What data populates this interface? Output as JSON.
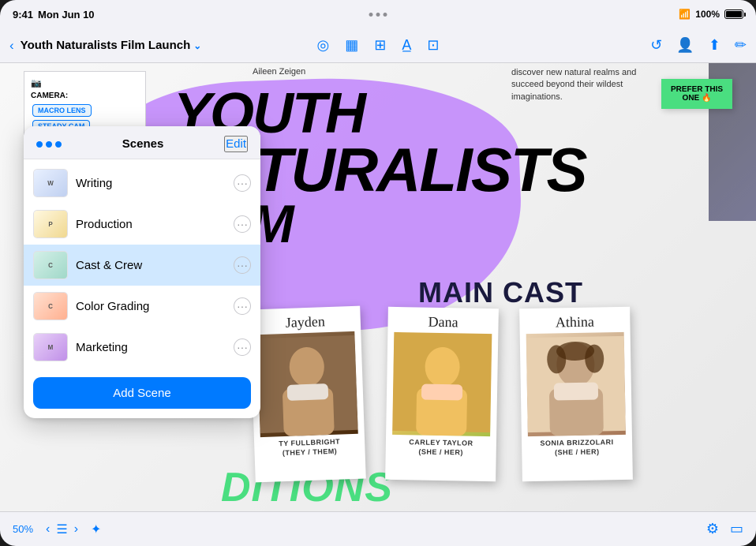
{
  "statusBar": {
    "time": "9:41",
    "date": "Mon Jun 10",
    "wifi": "WiFi",
    "battery": "100%"
  },
  "toolbar": {
    "backLabel": "‹",
    "title": "Youth Naturalists Film Launch",
    "chevron": "⌄",
    "editLabel": "Edit"
  },
  "toolbarCenter": {
    "icons": [
      "circle-icon",
      "rect-icon",
      "layers-icon",
      "text-icon",
      "image-icon"
    ]
  },
  "toolbarRight": {
    "icons": [
      "time-icon",
      "person-icon",
      "share-icon",
      "pencil-icon"
    ]
  },
  "canvas": {
    "authorName": "Aileen Zeigen",
    "subtitle": "discover new natural realms and succeed beyond their wildest imaginations.",
    "titleLine1": "YOUTH",
    "titleLine2": "NATuRALISTS",
    "titleLine3": "FILM",
    "mainCastLabel": "MAIN CAST",
    "bottomText": "DITIONS",
    "cameraLabel": "CAMERA:",
    "cameraOptions": [
      "MACRO LENS",
      "STEADY CAM"
    ],
    "stickyNote": "PREFER THIS ONE 🔥",
    "polaroids": [
      {
        "name": "Jayden",
        "caption": "TY FULLBRIGHT\n(THEY / THEM)",
        "bgClass": "polaroid-photo-1"
      },
      {
        "name": "Dana",
        "caption": "CARLEY TAYLOR\n(SHE / HER)",
        "bgClass": "polaroid-photo-2"
      },
      {
        "name": "Athina",
        "caption": "SONIA BRIZZOLARI\n(SHE / HER)",
        "bgClass": "polaroid-photo-3"
      }
    ]
  },
  "scenesPanel": {
    "title": "Scenes",
    "editLabel": "Edit",
    "scenes": [
      {
        "id": "writing",
        "name": "Writing",
        "active": false,
        "thumbClass": "thumb-writing"
      },
      {
        "id": "production",
        "name": "Production",
        "active": false,
        "thumbClass": "thumb-production"
      },
      {
        "id": "cast-crew",
        "name": "Cast & Crew",
        "active": true,
        "thumbClass": "thumb-cast"
      },
      {
        "id": "color-grading",
        "name": "Color Grading",
        "active": false,
        "thumbClass": "thumb-color"
      },
      {
        "id": "marketing",
        "name": "Marketing",
        "active": false,
        "thumbClass": "thumb-marketing"
      }
    ],
    "addSceneLabel": "Add Scene"
  },
  "bottomToolbar": {
    "zoomLevel": "50%",
    "navBack": "‹",
    "navForward": "›"
  }
}
